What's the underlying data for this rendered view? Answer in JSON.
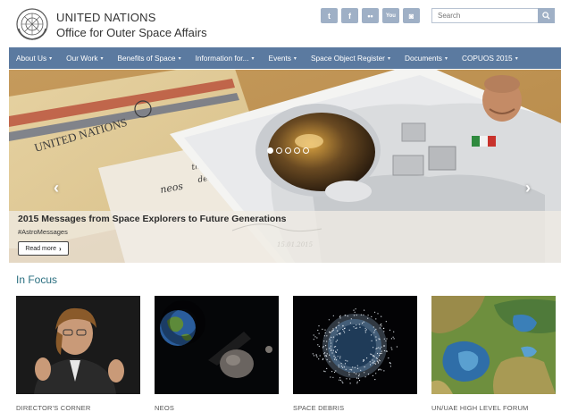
{
  "header": {
    "org_name": "UNITED NATIONS",
    "org_subtitle": "Office for Outer Space Affairs",
    "social": [
      {
        "icon": "twitter-icon",
        "glyph": "t"
      },
      {
        "icon": "facebook-icon",
        "glyph": "f"
      },
      {
        "icon": "flickr-icon",
        "glyph": "••"
      },
      {
        "icon": "youtube-icon",
        "glyph": "You"
      },
      {
        "icon": "instagram-icon",
        "glyph": "◙"
      }
    ],
    "search_placeholder": "Search"
  },
  "nav": {
    "items": [
      {
        "label": "About Us"
      },
      {
        "label": "Our Work"
      },
      {
        "label": "Benefits of Space"
      },
      {
        "label": "Information for..."
      },
      {
        "label": "Events"
      },
      {
        "label": "Space Object Register"
      },
      {
        "label": "Documents"
      },
      {
        "label": "COPUOS 2015"
      }
    ]
  },
  "hero": {
    "title": "2015 Messages from Space Explorers to Future Generations",
    "tag": "#AstroMessages",
    "read_more": "Read more",
    "envelope_text": "UNITED NATIONS",
    "note_text_1": "neos",
    "note_text_2": "the future",
    "note_text_3": "destiny."
  },
  "focus": {
    "heading": "In Focus",
    "cards": [
      {
        "label": "DIRECTOR'S CORNER"
      },
      {
        "label": "NEOS"
      },
      {
        "label": "SPACE DEBRIS"
      },
      {
        "label": "UN/UAE HIGH LEVEL FORUM"
      }
    ]
  },
  "colors": {
    "nav": "#5b7aa0",
    "social": "#9fb0c6",
    "heading": "#2a6f80"
  }
}
